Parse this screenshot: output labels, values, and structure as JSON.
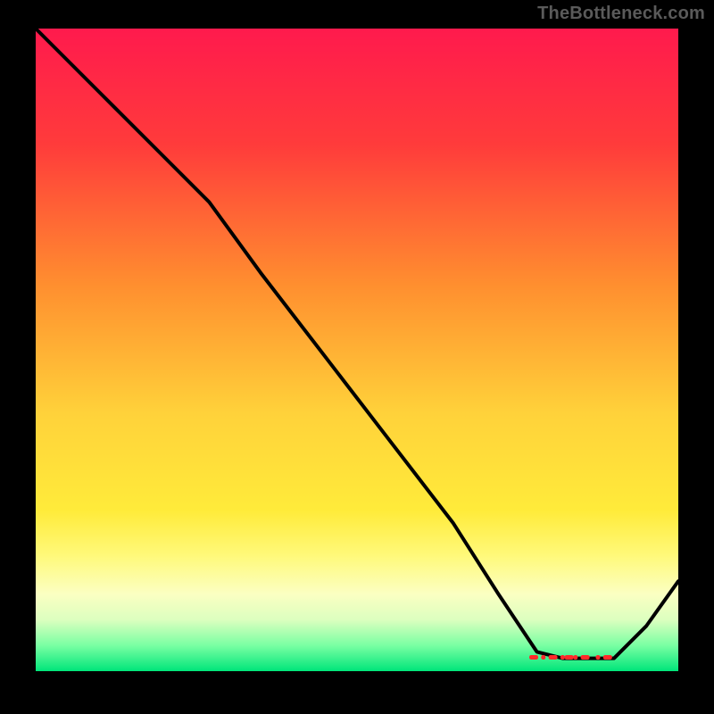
{
  "watermark": "TheBottleneck.com",
  "gradient_stops": [
    {
      "pct": 0,
      "color": "#ff1a4d"
    },
    {
      "pct": 18,
      "color": "#ff3b3b"
    },
    {
      "pct": 40,
      "color": "#ff8f2f"
    },
    {
      "pct": 60,
      "color": "#ffd23a"
    },
    {
      "pct": 75,
      "color": "#ffeb3a"
    },
    {
      "pct": 82,
      "color": "#fff97a"
    },
    {
      "pct": 88,
      "color": "#fbffc2"
    },
    {
      "pct": 92,
      "color": "#dcffbf"
    },
    {
      "pct": 96,
      "color": "#7affa3"
    },
    {
      "pct": 100,
      "color": "#00e57a"
    }
  ],
  "chart_data": {
    "type": "line",
    "title": "",
    "xlabel": "",
    "ylabel": "",
    "xlim": [
      0,
      100
    ],
    "ylim": [
      0,
      100
    ],
    "note": "Axis values estimated from pixel positions; y measures the black curve height where 0=bottom and 100=top of the gradient square. Flat band near x≈78–90 at y≈2 marks the optimum region (green zone). 'markers' are the small red dash/dot glyphs along that flat band.",
    "series": [
      {
        "name": "bottleneck-curve",
        "x": [
          0,
          10,
          20,
          27,
          35,
          45,
          55,
          65,
          72,
          78,
          82,
          86,
          90,
          95,
          100
        ],
        "y": [
          100,
          90,
          80,
          73,
          62,
          49,
          36,
          23,
          12,
          3,
          2,
          2,
          2,
          7,
          14
        ]
      }
    ],
    "markers": {
      "y": 2.15,
      "x": [
        77.5,
        79.0,
        80.5,
        82.0,
        83.0,
        84.0,
        85.5,
        87.5,
        89.0
      ],
      "color": "#ff2a2a"
    }
  }
}
